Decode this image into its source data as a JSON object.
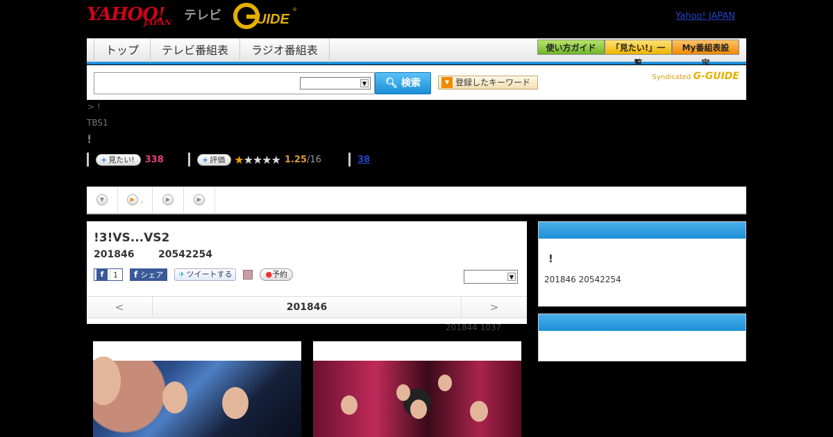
{
  "header": {
    "yahoo_logo": "YAHOO!",
    "yahoo_sub": "JAPAN",
    "tv_label": "テレビ",
    "gguide_logo": "G-GUIDE",
    "yahoo_japan_link": "Yahoo! JAPAN"
  },
  "nav": {
    "tabs": [
      {
        "label": "トップ"
      },
      {
        "label": "テレビ番組表"
      },
      {
        "label": "ラジオ番組表"
      }
    ],
    "buttons": {
      "guide": "使い方ガイド",
      "mitai_list": "「見たい!」一覧",
      "my_schedule": "My番組表設定"
    }
  },
  "search": {
    "input_value": "",
    "select_value": "",
    "button_label": "検索",
    "keyword_button": "登録したキーワード",
    "syndicated": "Syndicated",
    "syndicated_logo": "G-GUIDE"
  },
  "program": {
    "breadcrumb": "> !",
    "channel": "TBS1",
    "title": "!",
    "mitai_label": "見たい!",
    "mitai_count": "338",
    "rate_label": "評価",
    "rating": "1.25",
    "rating_count": "/16",
    "stars": 1,
    "link_count": "38"
  },
  "tabstrip": {
    "tab2_suffix": "."
  },
  "episode": {
    "title": "!3!VS...VS2",
    "date": "201846",
    "time": "20542254",
    "fb_like_count": "1",
    "fb_share": "シェア",
    "tweet": "ツイートする",
    "reserve": "予約",
    "select_value": "",
    "prev": "<",
    "current_date": "201846",
    "next": ">",
    "updated": "201844  1037"
  },
  "sidebar": {
    "title": "!",
    "meta": "201846  20542254"
  },
  "colors": {
    "accent_blue": "#1d8fd8",
    "pink": "#e5407a",
    "rating_orange": "#e09a2c"
  }
}
